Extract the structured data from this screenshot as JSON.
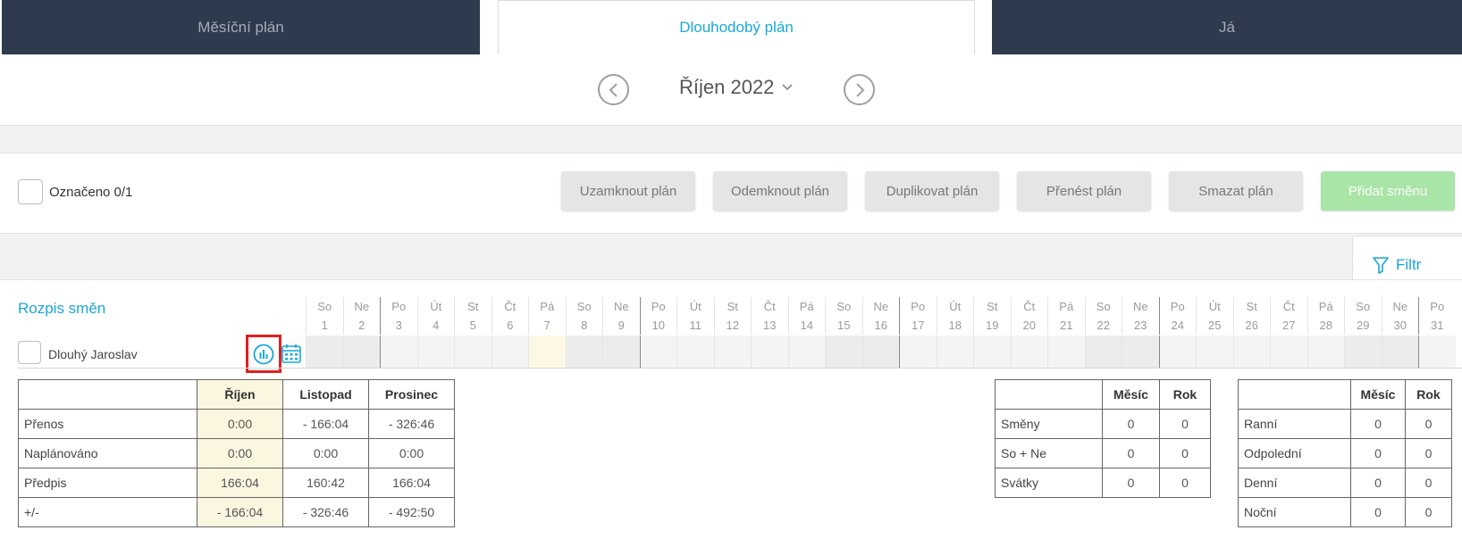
{
  "tabs": [
    "Měsíční plán",
    "Dlouhodobý plán",
    "Já"
  ],
  "month": {
    "title": "Říjen 2022"
  },
  "toolbar": {
    "selected_label": "Označeno 0/1",
    "buttons": [
      "Uzamknout plán",
      "Odemknout plán",
      "Duplikovat plán",
      "Přenést plán",
      "Smazat plán",
      "Přidat směnu"
    ]
  },
  "filter_label": "Filtr",
  "schedule": {
    "title": "Rozpis směn",
    "employee": "Dlouhý Jaroslav",
    "days": [
      {
        "d": "So",
        "n": "1"
      },
      {
        "d": "Ne",
        "n": "2"
      },
      {
        "d": "Po",
        "n": "3"
      },
      {
        "d": "Út",
        "n": "4"
      },
      {
        "d": "St",
        "n": "5"
      },
      {
        "d": "Čt",
        "n": "6"
      },
      {
        "d": "Pá",
        "n": "7"
      },
      {
        "d": "So",
        "n": "8"
      },
      {
        "d": "Ne",
        "n": "9"
      },
      {
        "d": "Po",
        "n": "10"
      },
      {
        "d": "Út",
        "n": "11"
      },
      {
        "d": "St",
        "n": "12"
      },
      {
        "d": "Čt",
        "n": "13"
      },
      {
        "d": "Pá",
        "n": "14"
      },
      {
        "d": "So",
        "n": "15"
      },
      {
        "d": "Ne",
        "n": "16"
      },
      {
        "d": "Po",
        "n": "17"
      },
      {
        "d": "Út",
        "n": "18"
      },
      {
        "d": "St",
        "n": "19"
      },
      {
        "d": "Čt",
        "n": "20"
      },
      {
        "d": "Pá",
        "n": "21"
      },
      {
        "d": "So",
        "n": "22"
      },
      {
        "d": "Ne",
        "n": "23"
      },
      {
        "d": "Po",
        "n": "24"
      },
      {
        "d": "Út",
        "n": "25"
      },
      {
        "d": "St",
        "n": "26"
      },
      {
        "d": "Čt",
        "n": "27"
      },
      {
        "d": "Pá",
        "n": "28"
      },
      {
        "d": "So",
        "n": "29"
      },
      {
        "d": "Ne",
        "n": "30"
      },
      {
        "d": "Po",
        "n": "31"
      }
    ]
  },
  "hours_table": {
    "headers": [
      "",
      "Říjen",
      "Listopad",
      "Prosinec"
    ],
    "rows": [
      [
        "Přenos",
        "0:00",
        "- 166:04",
        "- 326:46"
      ],
      [
        "Naplánováno",
        "0:00",
        "0:00",
        "0:00"
      ],
      [
        "Předpis",
        "166:04",
        "160:42",
        "166:04"
      ],
      [
        "+/-",
        "- 166:04",
        "- 326:46",
        "- 492:50"
      ]
    ]
  },
  "shifts_table": {
    "headers": [
      "",
      "Měsíc",
      "Rok"
    ],
    "rows": [
      [
        "Směny",
        "0",
        "0"
      ],
      [
        "So + Ne",
        "0",
        "0"
      ],
      [
        "Svátky",
        "0",
        "0"
      ]
    ]
  },
  "types_table": {
    "headers": [
      "",
      "Měsíc",
      "Rok"
    ],
    "rows": [
      [
        "Ranní",
        "0",
        "0"
      ],
      [
        "Odpolední",
        "0",
        "0"
      ],
      [
        "Denní",
        "0",
        "0"
      ],
      [
        "Noční",
        "0",
        "0"
      ]
    ]
  }
}
